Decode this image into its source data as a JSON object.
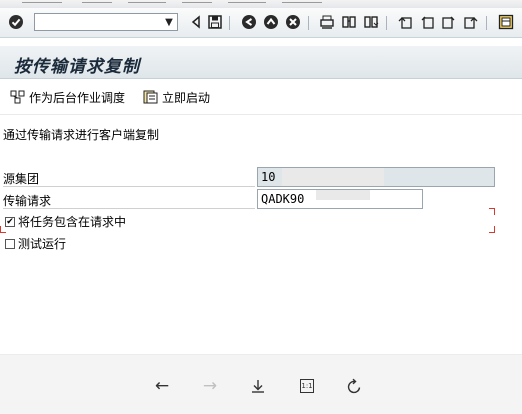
{
  "toolbar": {
    "command_field_value": "",
    "icons": [
      "enter-icon",
      "back-triangle-icon",
      "save-icon",
      "back-icon",
      "exit-icon",
      "cancel-icon",
      "print-icon",
      "find-icon",
      "find-next-icon",
      "first-page-icon",
      "previous-page-icon",
      "next-page-icon",
      "last-page-icon",
      "new-session-icon"
    ]
  },
  "title": "按传输请求复制",
  "app_toolbar": {
    "schedule_label": "作为后台作业调度",
    "immediate_label": "立即启动"
  },
  "form": {
    "description": "通过传输请求进行客户端复制",
    "source_client_label": "源集团",
    "source_client_value": "10",
    "transport_request_label": "传输请求",
    "transport_request_value": "QADK90",
    "include_tasks_label": "将任务包含在请求中",
    "include_tasks_checked": true,
    "test_run_label": "测试运行",
    "test_run_checked": false
  },
  "footer": {
    "buttons": [
      "back-arrow-icon",
      "forward-arrow-icon",
      "download-icon",
      "actual-size-icon",
      "refresh-icon"
    ],
    "actual_size_label": "1:1"
  },
  "colors": {
    "highlight_bracket": "#d63a2f",
    "title_text": "#1b2a3a"
  }
}
